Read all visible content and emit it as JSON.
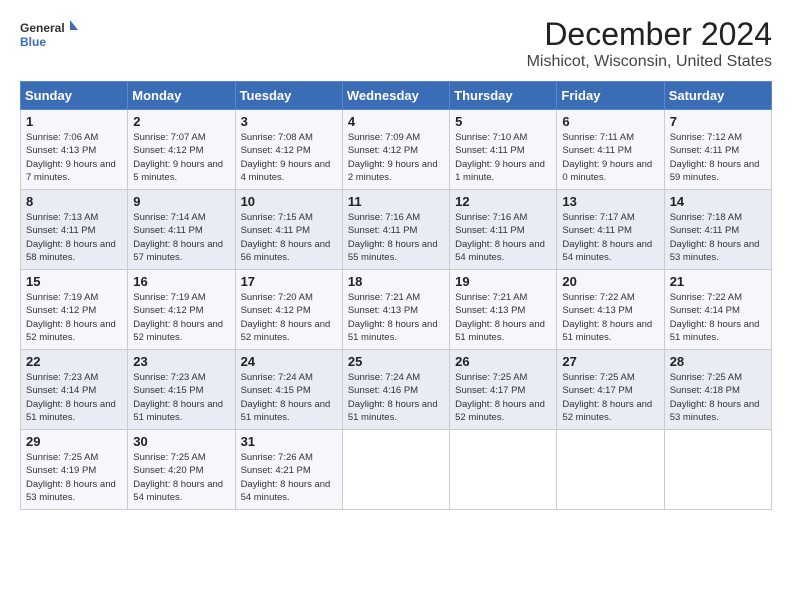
{
  "header": {
    "logo_line1": "General",
    "logo_line2": "Blue",
    "month": "December 2024",
    "location": "Mishicot, Wisconsin, United States"
  },
  "days_of_week": [
    "Sunday",
    "Monday",
    "Tuesday",
    "Wednesday",
    "Thursday",
    "Friday",
    "Saturday"
  ],
  "weeks": [
    [
      {
        "day": "1",
        "sunrise": "7:06 AM",
        "sunset": "4:13 PM",
        "daylight": "9 hours and 7 minutes."
      },
      {
        "day": "2",
        "sunrise": "7:07 AM",
        "sunset": "4:12 PM",
        "daylight": "9 hours and 5 minutes."
      },
      {
        "day": "3",
        "sunrise": "7:08 AM",
        "sunset": "4:12 PM",
        "daylight": "9 hours and 4 minutes."
      },
      {
        "day": "4",
        "sunrise": "7:09 AM",
        "sunset": "4:12 PM",
        "daylight": "9 hours and 2 minutes."
      },
      {
        "day": "5",
        "sunrise": "7:10 AM",
        "sunset": "4:11 PM",
        "daylight": "9 hours and 1 minute."
      },
      {
        "day": "6",
        "sunrise": "7:11 AM",
        "sunset": "4:11 PM",
        "daylight": "9 hours and 0 minutes."
      },
      {
        "day": "7",
        "sunrise": "7:12 AM",
        "sunset": "4:11 PM",
        "daylight": "8 hours and 59 minutes."
      }
    ],
    [
      {
        "day": "8",
        "sunrise": "7:13 AM",
        "sunset": "4:11 PM",
        "daylight": "8 hours and 58 minutes."
      },
      {
        "day": "9",
        "sunrise": "7:14 AM",
        "sunset": "4:11 PM",
        "daylight": "8 hours and 57 minutes."
      },
      {
        "day": "10",
        "sunrise": "7:15 AM",
        "sunset": "4:11 PM",
        "daylight": "8 hours and 56 minutes."
      },
      {
        "day": "11",
        "sunrise": "7:16 AM",
        "sunset": "4:11 PM",
        "daylight": "8 hours and 55 minutes."
      },
      {
        "day": "12",
        "sunrise": "7:16 AM",
        "sunset": "4:11 PM",
        "daylight": "8 hours and 54 minutes."
      },
      {
        "day": "13",
        "sunrise": "7:17 AM",
        "sunset": "4:11 PM",
        "daylight": "8 hours and 54 minutes."
      },
      {
        "day": "14",
        "sunrise": "7:18 AM",
        "sunset": "4:11 PM",
        "daylight": "8 hours and 53 minutes."
      }
    ],
    [
      {
        "day": "15",
        "sunrise": "7:19 AM",
        "sunset": "4:12 PM",
        "daylight": "8 hours and 52 minutes."
      },
      {
        "day": "16",
        "sunrise": "7:19 AM",
        "sunset": "4:12 PM",
        "daylight": "8 hours and 52 minutes."
      },
      {
        "day": "17",
        "sunrise": "7:20 AM",
        "sunset": "4:12 PM",
        "daylight": "8 hours and 52 minutes."
      },
      {
        "day": "18",
        "sunrise": "7:21 AM",
        "sunset": "4:13 PM",
        "daylight": "8 hours and 51 minutes."
      },
      {
        "day": "19",
        "sunrise": "7:21 AM",
        "sunset": "4:13 PM",
        "daylight": "8 hours and 51 minutes."
      },
      {
        "day": "20",
        "sunrise": "7:22 AM",
        "sunset": "4:13 PM",
        "daylight": "8 hours and 51 minutes."
      },
      {
        "day": "21",
        "sunrise": "7:22 AM",
        "sunset": "4:14 PM",
        "daylight": "8 hours and 51 minutes."
      }
    ],
    [
      {
        "day": "22",
        "sunrise": "7:23 AM",
        "sunset": "4:14 PM",
        "daylight": "8 hours and 51 minutes."
      },
      {
        "day": "23",
        "sunrise": "7:23 AM",
        "sunset": "4:15 PM",
        "daylight": "8 hours and 51 minutes."
      },
      {
        "day": "24",
        "sunrise": "7:24 AM",
        "sunset": "4:15 PM",
        "daylight": "8 hours and 51 minutes."
      },
      {
        "day": "25",
        "sunrise": "7:24 AM",
        "sunset": "4:16 PM",
        "daylight": "8 hours and 51 minutes."
      },
      {
        "day": "26",
        "sunrise": "7:25 AM",
        "sunset": "4:17 PM",
        "daylight": "8 hours and 52 minutes."
      },
      {
        "day": "27",
        "sunrise": "7:25 AM",
        "sunset": "4:17 PM",
        "daylight": "8 hours and 52 minutes."
      },
      {
        "day": "28",
        "sunrise": "7:25 AM",
        "sunset": "4:18 PM",
        "daylight": "8 hours and 53 minutes."
      }
    ],
    [
      {
        "day": "29",
        "sunrise": "7:25 AM",
        "sunset": "4:19 PM",
        "daylight": "8 hours and 53 minutes."
      },
      {
        "day": "30",
        "sunrise": "7:25 AM",
        "sunset": "4:20 PM",
        "daylight": "8 hours and 54 minutes."
      },
      {
        "day": "31",
        "sunrise": "7:26 AM",
        "sunset": "4:21 PM",
        "daylight": "8 hours and 54 minutes."
      },
      null,
      null,
      null,
      null
    ]
  ],
  "labels": {
    "sunrise": "Sunrise: ",
    "sunset": "Sunset: ",
    "daylight": "Daylight: "
  }
}
